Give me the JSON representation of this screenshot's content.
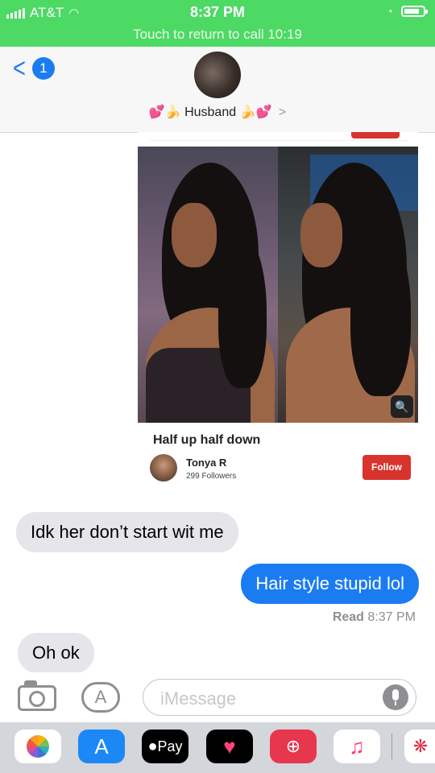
{
  "status_bar": {
    "carrier": "AT&T",
    "time": "8:37 PM",
    "call_banner": "Touch to return to call 10:19",
    "battery_level": 0.85,
    "colors": {
      "background": "#4cd964"
    }
  },
  "header": {
    "back_count": "1",
    "contact_name": "Husband",
    "contact_prefix_emoji": "💕🍌",
    "contact_suffix_emoji": "🍌💕",
    "chevron": ">"
  },
  "pin": {
    "title": "Half up half down",
    "author": "Tonya R",
    "followers": "299 Followers",
    "follow_label": "Follow",
    "lens_icon": "🔍",
    "colors": {
      "follow": "#d8332c"
    }
  },
  "messages": [
    {
      "direction": "received",
      "text": "Idk her don’t start wit me"
    },
    {
      "direction": "sent",
      "text": "Hair style stupid lol"
    },
    {
      "direction": "received",
      "text": "Oh ok"
    }
  ],
  "read_receipt": {
    "label": "Read",
    "time": "8:37 PM"
  },
  "input_bar": {
    "placeholder": "iMessage",
    "apps_icon": "A"
  },
  "app_drawer": {
    "items": [
      {
        "name": "photos-app-icon",
        "glyph": ""
      },
      {
        "name": "app-store-app-icon",
        "glyph": "A"
      },
      {
        "name": "apple-pay-app-icon",
        "glyph": "Pay"
      },
      {
        "name": "digital-touch-app-icon",
        "glyph": "♥"
      },
      {
        "name": "web-search-app-icon",
        "glyph": "⊕"
      },
      {
        "name": "music-app-icon",
        "glyph": "♫"
      },
      {
        "name": "more-app-icon",
        "glyph": "❋"
      }
    ],
    "colors": {
      "accent": "#1b7cf2"
    }
  }
}
